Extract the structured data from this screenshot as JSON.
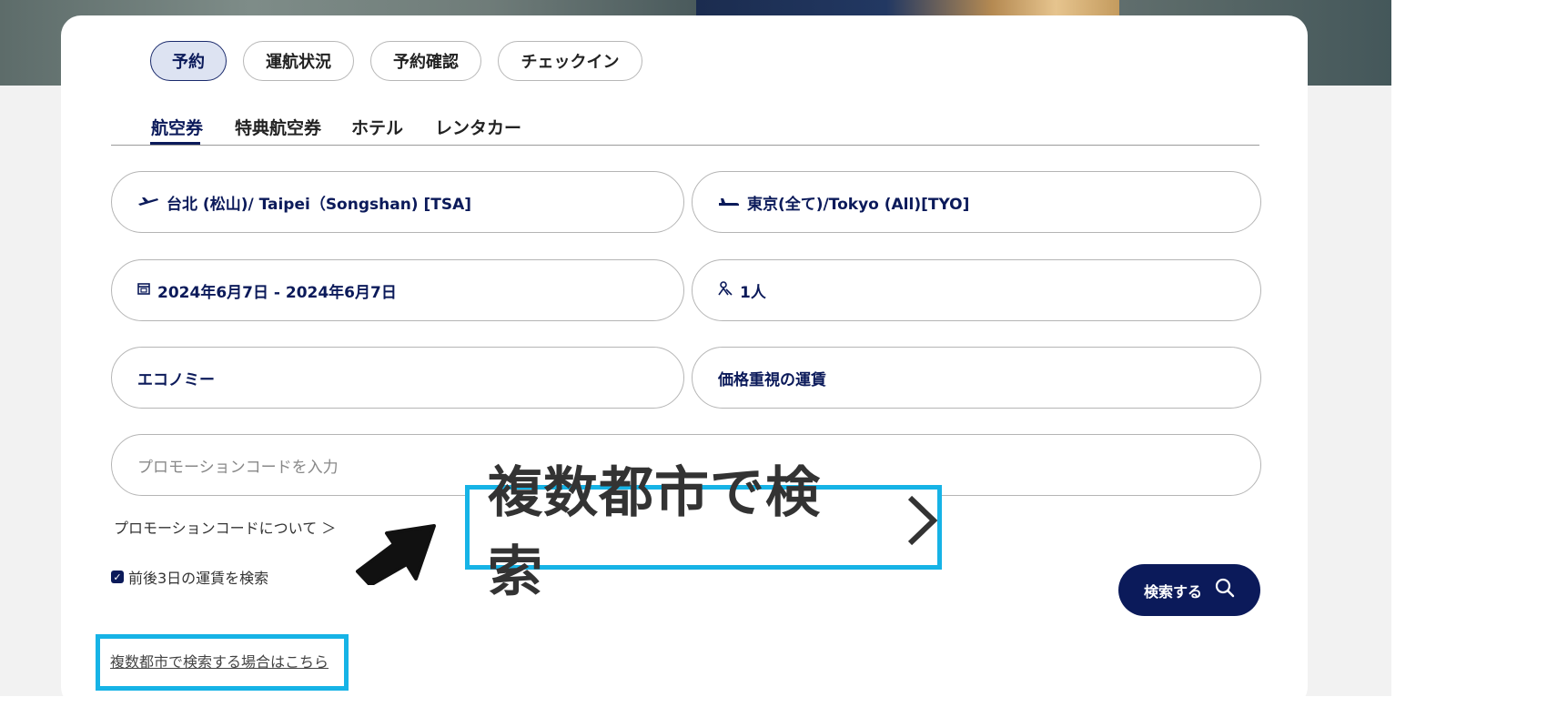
{
  "booking_tabs": [
    "予約",
    "運航状況",
    "予約確認",
    "チェックイン"
  ],
  "sub_tabs": [
    "航空券",
    "特典航空券",
    "ホテル",
    "レンタカー"
  ],
  "form": {
    "origin": "台北 (松山)/ Taipei（Songshan) [TSA]",
    "destination": "東京(全て)/Tokyo (All)[TYO]",
    "dates": "2024年6月7日 - 2024年6月7日",
    "passengers": "1人",
    "cabin_class": "エコノミー",
    "fare_type": "価格重視の運賃",
    "promo_placeholder": "プロモーションコードを入力"
  },
  "promo_info_link": "プロモーションコードについて ＞",
  "flexible_dates_label": "前後3日の運賃を検索",
  "flexible_dates_checked": true,
  "search_button": "検索する",
  "callout_text": "複数都市で検索",
  "multi_city_link": "複数都市で検索する場合はこちら",
  "colors": {
    "navy": "#0b1a5a",
    "highlight": "#16b3e6",
    "tab_active_bg": "#dde3f2"
  },
  "icons": {
    "departure": "plane-takeoff-icon",
    "arrival": "plane-landing-icon",
    "calendar": "calendar-icon",
    "passengers": "person-icon",
    "search": "magnifier-icon"
  }
}
